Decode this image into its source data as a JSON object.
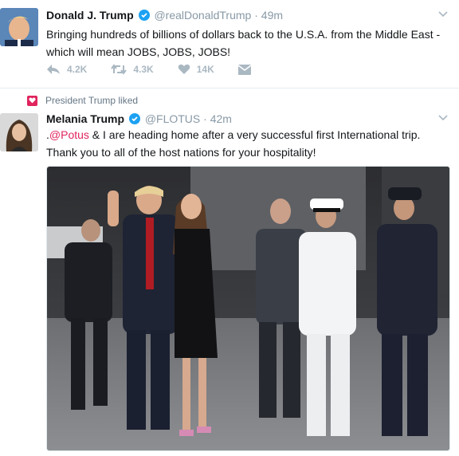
{
  "tweet1": {
    "name": "Donald J. Trump",
    "handle": "@realDonaldTrump",
    "sep": "·",
    "time": "49m",
    "text": "Bringing hundreds of billions of dollars back to the U.S.A. from the Middle East - which will mean JOBS, JOBS, JOBS!",
    "reply_icon": "reply-icon",
    "retweets": "4.3K",
    "likes": "14K",
    "replies": "4.2K"
  },
  "liked_banner": {
    "text": "President Trump liked",
    "icon": "heart-icon"
  },
  "tweet2": {
    "name": "Melania Trump",
    "handle": "@FLOTUS",
    "sep": "·",
    "time": "42m",
    "mention_prefix": ".",
    "mention": "@Potus",
    "text_line1": " & I are heading home after a very successful first International trip.",
    "text_line2": "Thank you to all of the host nations for your hospitality!"
  },
  "colors": {
    "verified": "#1da1f2",
    "muted": "#8899a6",
    "mention": "#e0245e",
    "liked_badge": "#e0245e"
  }
}
